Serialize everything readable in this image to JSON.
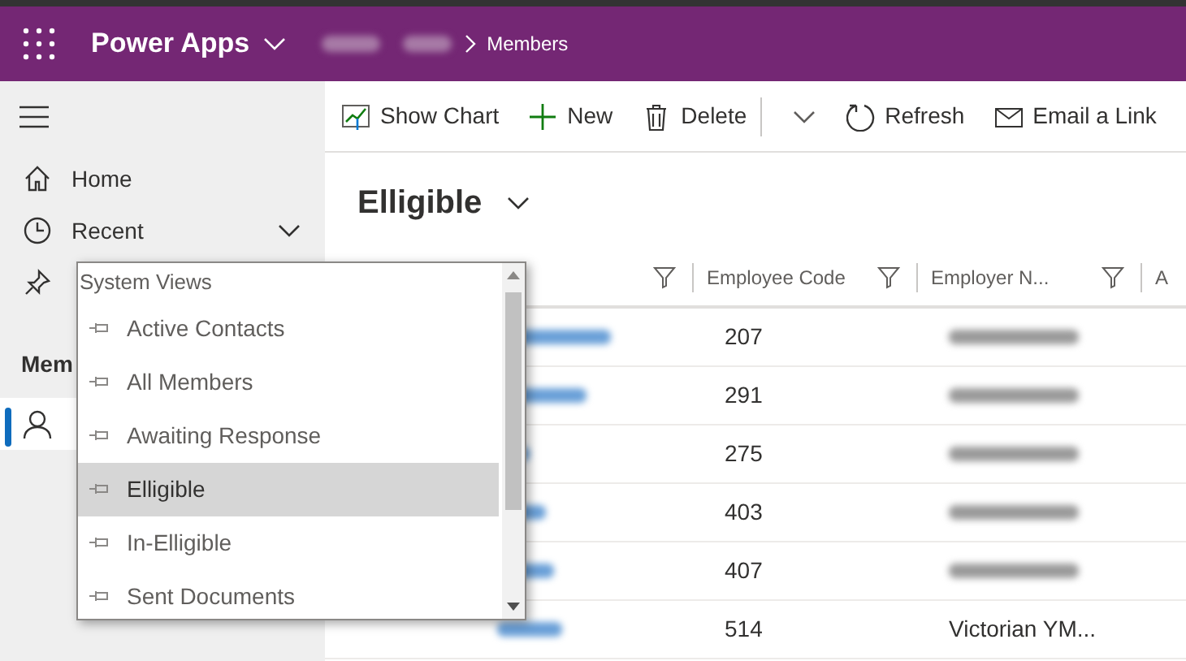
{
  "header": {
    "app_name": "Power Apps",
    "breadcrumb_current": "Members"
  },
  "command_bar": [
    {
      "kind": "chart",
      "label": "Show Chart"
    },
    {
      "kind": "new",
      "label": "New"
    },
    {
      "kind": "delete",
      "label": "Delete"
    },
    {
      "kind": "more"
    },
    {
      "kind": "refresh",
      "label": "Refresh"
    },
    {
      "kind": "email",
      "label": "Email a Link"
    }
  ],
  "sidebar": {
    "items": [
      {
        "kind": "home",
        "label": "Home",
        "selected": false
      },
      {
        "kind": "recent",
        "label": "Recent",
        "selected": false,
        "expandable": true
      },
      {
        "kind": "pin",
        "selected": false
      }
    ],
    "section": "Mem",
    "section_items": [
      {
        "kind": "person",
        "selected": true
      }
    ]
  },
  "view": {
    "title": "Elligible"
  },
  "view_menu": {
    "group": "System Views",
    "items": [
      {
        "label": "Active Contacts",
        "selected": false
      },
      {
        "label": "All Members",
        "selected": false
      },
      {
        "label": "Awaiting Response",
        "selected": false
      },
      {
        "label": "Elligible",
        "selected": true
      },
      {
        "label": "In-Elligible",
        "selected": false
      },
      {
        "label": "Sent Documents",
        "selected": false
      }
    ]
  },
  "table": {
    "columns": [
      "",
      "Employee Code",
      "Employer N...",
      "A"
    ],
    "rows": [
      [
        "",
        "207",
        ""
      ],
      [
        "",
        "291",
        ""
      ],
      [
        "",
        "275",
        ""
      ],
      [
        "",
        "403",
        ""
      ],
      [
        "",
        "407",
        ""
      ],
      [
        "",
        "514",
        "Victorian YM..."
      ]
    ]
  }
}
